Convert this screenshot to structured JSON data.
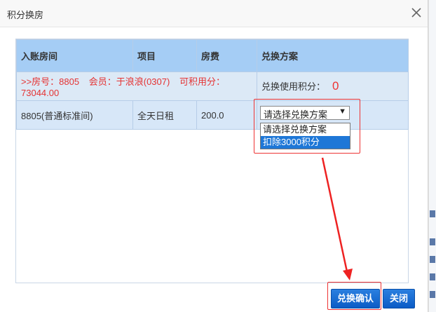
{
  "dialog": {
    "title": "积分换房"
  },
  "table": {
    "headers": [
      "入账房间",
      "项目",
      "房费",
      "兑换方案"
    ],
    "info": {
      "room": ">>房号：8805",
      "member": "会员：于浪浪(0307)",
      "points": "可积用分：73044.00",
      "used_label": "兑换使用积分：",
      "used_value": "0"
    },
    "row": {
      "room": "8805(普通标准间)",
      "item": "全天日租",
      "fee": "200.0"
    }
  },
  "select": {
    "selected": "请选择兑换方案",
    "arrow": "▼",
    "options": [
      "请选择兑换方案",
      "扣除3000积分"
    ],
    "highlighted_index": 1
  },
  "buttons": {
    "confirm": "兑换确认",
    "close": "关闭"
  },
  "colors": {
    "header_bg": "#a5cdf5",
    "info_text": "#e53333",
    "button_blue": "#0b5cc6",
    "annotation_red": "#ee3333"
  }
}
